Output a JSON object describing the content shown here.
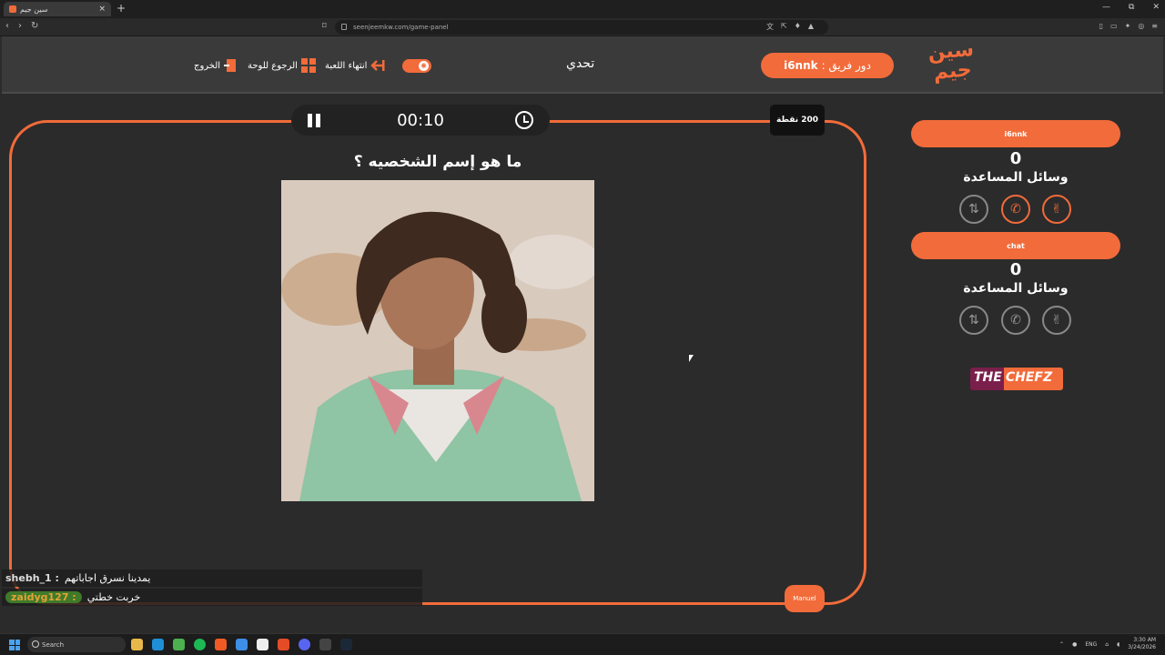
{
  "browser": {
    "tab_title": "سين جيم",
    "tab_close": "×",
    "new_tab": "+",
    "url": "seenjeemkw.com/game-panel",
    "window_controls": [
      "—",
      "⧉",
      "✕"
    ]
  },
  "header": {
    "logo_line1": "سين",
    "logo_line2": "جيم",
    "turn_label": "دور فريق :",
    "turn_team": "i6nnk",
    "mode": "تحدي",
    "end_game": "انتهاء اللعبة",
    "back_to_board": "الرجوع للوحة",
    "exit": "الخروج"
  },
  "game": {
    "timer": "00:10",
    "points": "200 نقطة",
    "question": "ما هو إسم الشخصيه ؟",
    "manual_label": "Manuel"
  },
  "teams": [
    {
      "name": "i6nnk",
      "score": "0",
      "aids_label": "وسائل المساعدة",
      "aids": [
        {
          "icon": "hand-peace-icon",
          "active": true
        },
        {
          "icon": "phone-icon",
          "active": true
        },
        {
          "icon": "swap-icon",
          "active": false
        }
      ]
    },
    {
      "name": "chat",
      "score": "0",
      "aids_label": "وسائل المساعدة",
      "aids": [
        {
          "icon": "hand-peace-icon",
          "active": false
        },
        {
          "icon": "phone-icon",
          "active": false
        },
        {
          "icon": "swap-icon",
          "active": false
        }
      ]
    }
  ],
  "sponsor": {
    "part1": "THE",
    "part2": "CHEFZ"
  },
  "chat_overlay": [
    {
      "user": "shebh_1 :",
      "message": "يمدينا نسرق اجاباتهم"
    },
    {
      "user": "zaidyg127 :",
      "message": "خربت خطتي"
    }
  ],
  "taskbar": {
    "search_placeholder": "Search",
    "lang": "ENG",
    "time": "3:30 AM",
    "date": "3/24/2026"
  },
  "colors": {
    "accent": "#f26b3a",
    "bg": "#2b2b2b",
    "header": "#3a3a3a"
  }
}
